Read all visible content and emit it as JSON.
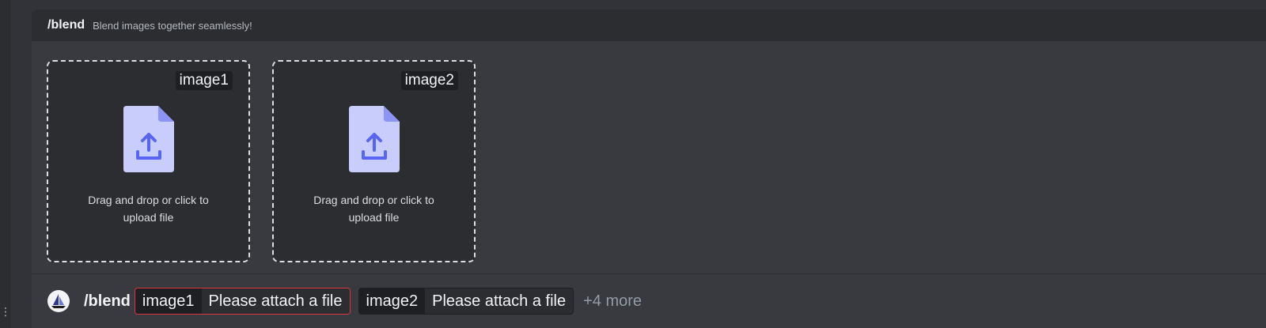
{
  "command": {
    "name": "/blend",
    "description": "Blend images together seamlessly!"
  },
  "uploads": [
    {
      "tag": "image1",
      "text": "Drag and drop or click to upload file"
    },
    {
      "tag": "image2",
      "text": "Drag and drop or click to upload file"
    }
  ],
  "input_bar": {
    "command": "/blend",
    "options": [
      {
        "name": "image1",
        "value": "Please attach a file",
        "state": "error"
      },
      {
        "name": "image2",
        "value": "Please attach a file",
        "state": "normal"
      }
    ],
    "more_label": "+4 more"
  },
  "icons": {
    "upload": "file-upload-icon",
    "avatar": "bot-avatar-icon"
  },
  "colors": {
    "icon_page": "#c9cdfb",
    "icon_accent": "#5865f2",
    "error_border": "#da373c"
  }
}
